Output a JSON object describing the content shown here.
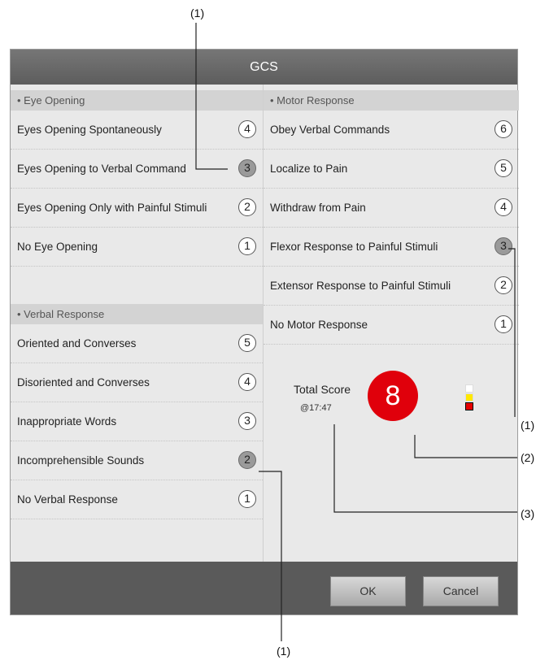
{
  "callouts": {
    "top": "(1)",
    "right1": "(1)",
    "right2": "(2)",
    "right3": "(3)",
    "bottom": "(1)"
  },
  "dialog": {
    "title": "GCS",
    "eye": {
      "header": "• Eye Opening",
      "items": [
        {
          "label": "Eyes Opening Spontaneously",
          "score": "4",
          "selected": false
        },
        {
          "label": "Eyes Opening to Verbal Command",
          "score": "3",
          "selected": true
        },
        {
          "label": "Eyes Opening Only with Painful Stimuli",
          "score": "2",
          "selected": false
        },
        {
          "label": "No Eye Opening",
          "score": "1",
          "selected": false
        }
      ]
    },
    "verbal": {
      "header": "• Verbal Response",
      "items": [
        {
          "label": "Oriented and Converses",
          "score": "5",
          "selected": false
        },
        {
          "label": "Disoriented and Converses",
          "score": "4",
          "selected": false
        },
        {
          "label": "Inappropriate Words",
          "score": "3",
          "selected": false
        },
        {
          "label": "Incomprehensible Sounds",
          "score": "2",
          "selected": true
        },
        {
          "label": "No Verbal Response",
          "score": "1",
          "selected": false
        }
      ]
    },
    "motor": {
      "header": "• Motor Response",
      "items": [
        {
          "label": "Obey Verbal Commands",
          "score": "6",
          "selected": false
        },
        {
          "label": "Localize to Pain",
          "score": "5",
          "selected": false
        },
        {
          "label": "Withdraw from Pain",
          "score": "4",
          "selected": false
        },
        {
          "label": "Flexor Response to Painful Stimuli",
          "score": "3",
          "selected": true
        },
        {
          "label": "Extensor Response to Painful Stimuli",
          "score": "2",
          "selected": false
        },
        {
          "label": "No Motor Response",
          "score": "1",
          "selected": false
        }
      ]
    },
    "total": {
      "label": "Total Score",
      "time": "@17:47",
      "score": "8",
      "score_color": "#e0000b",
      "legend_colors": [
        "#ffffff",
        "#ffe800",
        "#e60000"
      ]
    },
    "buttons": {
      "ok": "OK",
      "cancel": "Cancel"
    }
  }
}
